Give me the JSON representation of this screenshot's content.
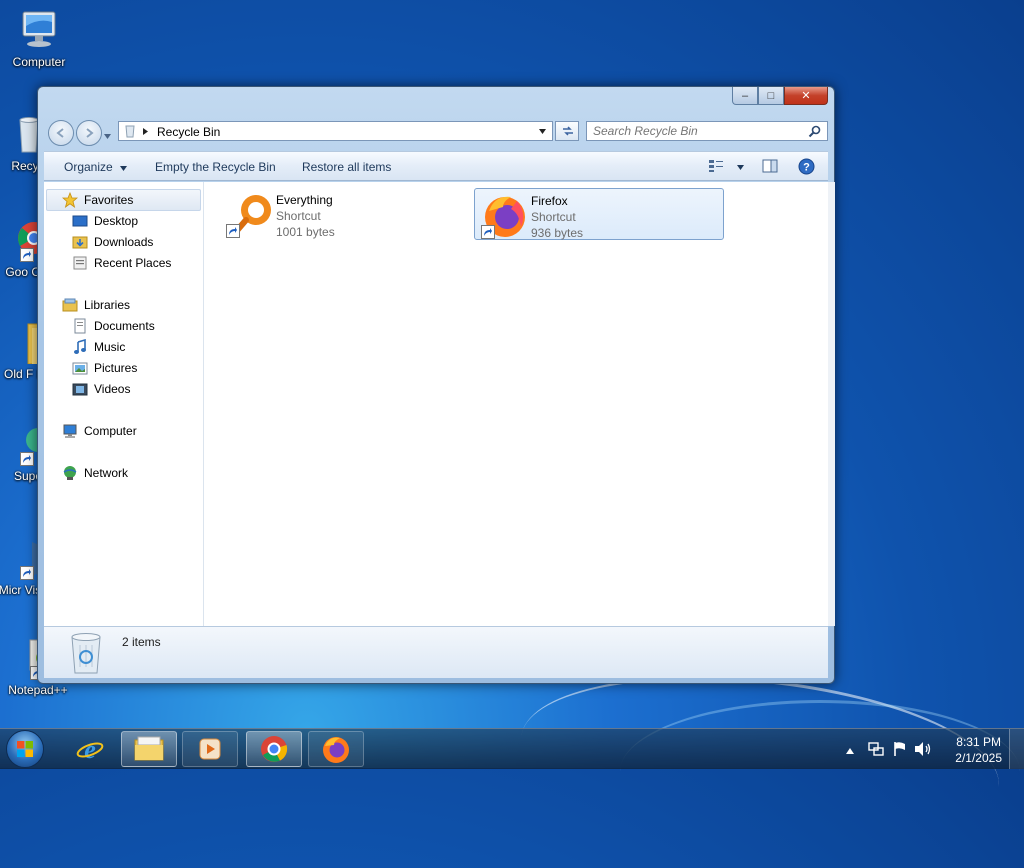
{
  "desktop": {
    "icons": [
      {
        "label": "Computer"
      },
      {
        "label": "Recyc"
      },
      {
        "label": "Goo Chr"
      },
      {
        "label": "Old F Da"
      },
      {
        "label": "Supe"
      },
      {
        "label": "Micr Visual"
      },
      {
        "label": "Notepad++"
      }
    ]
  },
  "window": {
    "title_buttons": {
      "minimize": "–",
      "maximize": "□",
      "close": "✕"
    },
    "address": {
      "location": "Recycle Bin"
    },
    "search": {
      "placeholder": "Search Recycle Bin"
    },
    "toolbar": {
      "organize": "Organize",
      "empty": "Empty the Recycle Bin",
      "restore": "Restore all items"
    },
    "nav": {
      "favorites": "Favorites",
      "desktop": "Desktop",
      "downloads": "Downloads",
      "recent": "Recent Places",
      "libraries": "Libraries",
      "documents": "Documents",
      "music": "Music",
      "pictures": "Pictures",
      "videos": "Videos",
      "computer": "Computer",
      "network": "Network"
    },
    "files": [
      {
        "name": "Everything",
        "type": "Shortcut",
        "size": "1001 bytes"
      },
      {
        "name": "Firefox",
        "type": "Shortcut",
        "size": "936 bytes"
      }
    ],
    "status": {
      "count": "2 items"
    }
  },
  "taskbar": {
    "time": "8:31 PM",
    "date": "2/1/2025"
  }
}
